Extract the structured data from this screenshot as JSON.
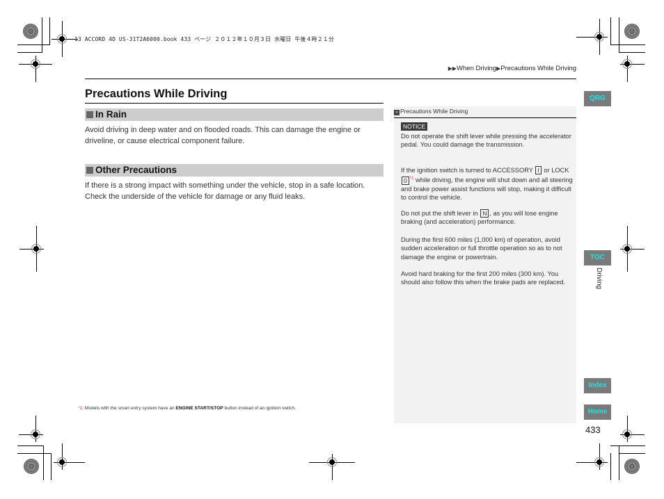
{
  "print_job_line": "13 ACCORD 4D US-31T2A6000.book  433 ページ  ２０１２年１０月３日  水曜日  午後４時２１分",
  "breadcrumb": {
    "items": [
      "When Driving",
      "Precautions While Driving"
    ]
  },
  "page_title": "Precautions While Driving",
  "sections": [
    {
      "heading": "In Rain",
      "body": "Avoid driving in deep water and on flooded roads. This can damage the engine or driveline, or cause electrical component failure."
    },
    {
      "heading": "Other Precautions",
      "body": "If there is a strong impact with something under the vehicle, stop in a safe location. Check the underside of the vehicle for damage or any fluid leaks."
    }
  ],
  "sidebar": {
    "heading": "Precautions While Driving",
    "notice_label": "NOTICE",
    "notice_text": "Do not operate the shift lever while pressing the accelerator pedal. You could damage the transmission.",
    "para_ignition": {
      "part1": "If the ignition switch is turned to ACCESSORY",
      "key_accessory": "I",
      "part2": "or LOCK",
      "key_lock": "0",
      "footnote_ref": "*1",
      "part3": "while driving, the engine will shut down and all steering and brake power assist functions will stop, making it difficult to control the vehicle."
    },
    "para_neutral": {
      "part1": "Do not put the shift lever in",
      "key": "N",
      "part2": ", as you will lose engine braking (and acceleration) performance."
    },
    "para_break_in": "During the first 600 miles (1,000 km) of operation, avoid sudden acceleration or full throttle operation so as to not damage the engine or powertrain.",
    "para_brakes": "Avoid hard braking for the first 200 miles (300 km). You should also follow this when the brake pads are replaced."
  },
  "footnote": {
    "marker": "*1",
    "text_before": ": Models with the smart entry system have an ",
    "bold": "ENGINE START/STOP",
    "text_after": "  button instead of an ignition switch."
  },
  "nav_tabs": {
    "qrg": "QRG",
    "toc": "TOC",
    "index": "Index",
    "home": "Home"
  },
  "chapter_label": "Driving",
  "page_number": "433",
  "colors": {
    "tab_bg": "#7a7a7a",
    "tab_text": "#19e6e6",
    "section_bar": "#cdcdcd",
    "sidebar_bg": "#f2f2f2",
    "footnote_marker": "#e03a3a"
  }
}
